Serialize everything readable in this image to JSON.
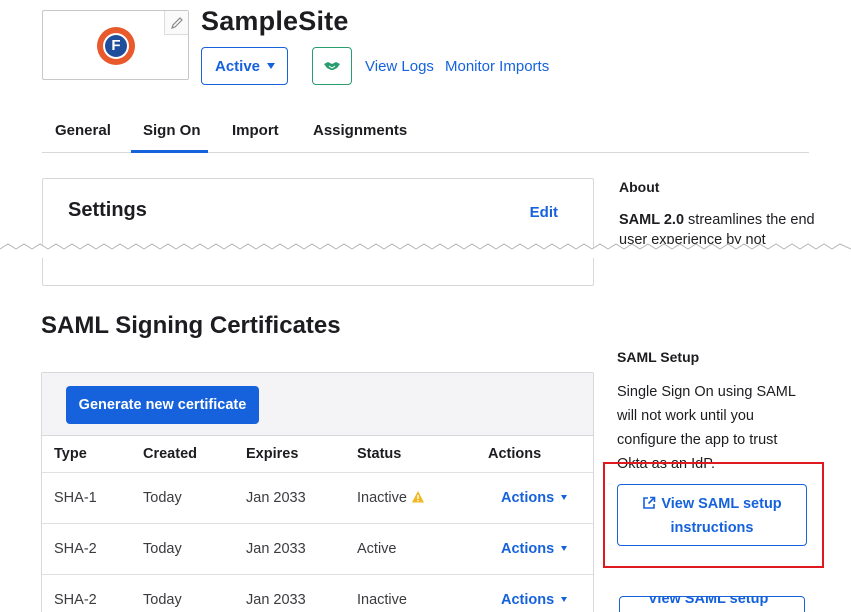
{
  "app": {
    "title": "SampleSite",
    "status": "Active",
    "links": {
      "view_logs": "View Logs",
      "monitor_imports": "Monitor Imports"
    }
  },
  "tabs": [
    "General",
    "Sign On",
    "Import",
    "Assignments"
  ],
  "active_tab": "Sign On",
  "settings": {
    "title": "Settings",
    "edit": "Edit"
  },
  "about": {
    "title": "About",
    "text_bold": "SAML 2.0",
    "text": " streamlines the end user experience by not"
  },
  "certificates": {
    "heading": "SAML Signing Certificates",
    "generate_button": "Generate new certificate",
    "columns": [
      "Type",
      "Created",
      "Expires",
      "Status",
      "Actions"
    ],
    "rows": [
      {
        "type": "SHA-1",
        "created": "Today",
        "expires": "Jan 2033",
        "status": "Inactive",
        "action": "Actions",
        "warning": true
      },
      {
        "type": "SHA-2",
        "created": "Today",
        "expires": "Jan 2033",
        "status": "Active",
        "action": "Actions",
        "warning": false
      },
      {
        "type": "SHA-2",
        "created": "Today",
        "expires": "Jan 2033",
        "status": "Inactive",
        "action": "Actions",
        "warning": false
      }
    ]
  },
  "saml_setup": {
    "title": "SAML Setup",
    "text": "Single Sign On using SAML will not work until you configure the app to trust Okta as an IdP.",
    "button": "View SAML setup instructions",
    "button_cut": "View SAML setup"
  },
  "icons": {
    "logo": "f-circle-logo",
    "edit": "pencil-icon",
    "handshake": "handshake-icon",
    "warning": "warning-icon",
    "external": "external-link-icon"
  },
  "colors": {
    "primary": "#1662dd",
    "green": "#2a9d6f",
    "highlight": "#e0181f",
    "warning": "#f2b824",
    "logo_orange": "#e8592c"
  }
}
